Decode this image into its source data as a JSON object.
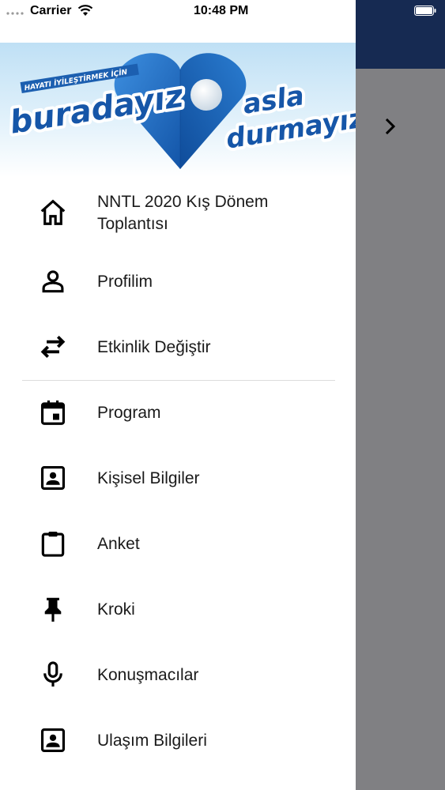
{
  "status_bar": {
    "carrier": "Carrier",
    "time": "10:48 PM"
  },
  "banner": {
    "tagline_small": "HAYATI İYİLEŞTİRMEK İÇİN",
    "left_word": "buradayız",
    "right_top": "asla",
    "right_bottom": "durmayız"
  },
  "menu": {
    "items": [
      {
        "label_line1": "NNTL 2020 Kış Dönem",
        "label_line2": "Toplantısı",
        "icon": "home-icon"
      },
      {
        "label": "Profilim",
        "icon": "person-icon"
      },
      {
        "label": "Etkinlik Değiştir",
        "icon": "swap-arrows-icon"
      },
      {
        "label": "Program",
        "icon": "calendar-icon"
      },
      {
        "label": "Kişisel Bilgiler",
        "icon": "contact-card-icon"
      },
      {
        "label": "Anket",
        "icon": "clipboard-icon"
      },
      {
        "label": "Kroki",
        "icon": "pin-icon"
      },
      {
        "label": "Konuşmacılar",
        "icon": "microphone-icon"
      },
      {
        "label": "Ulaşım Bilgileri",
        "icon": "contact-card-icon"
      }
    ]
  },
  "colors": {
    "navbar": "#162a52",
    "overlay": "#808083",
    "heart_blue": "#1e6fc4"
  }
}
